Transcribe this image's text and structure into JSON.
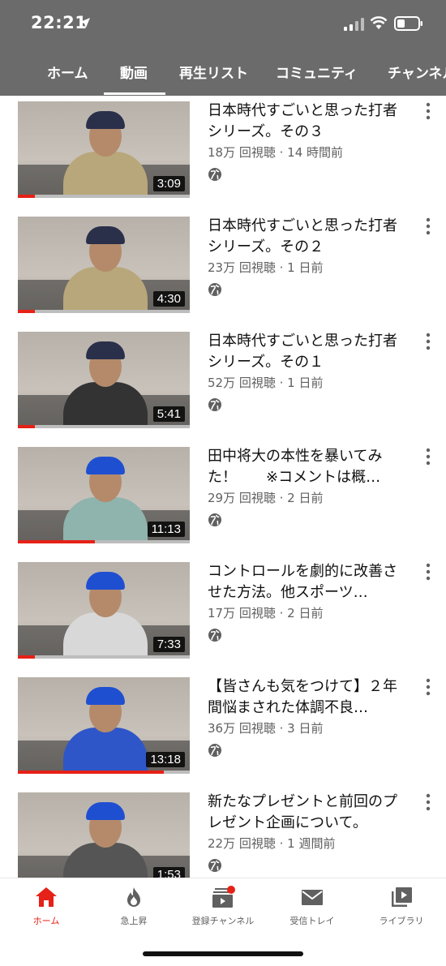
{
  "status_bar": {
    "time": "22:21"
  },
  "tabs": [
    {
      "label": "ホーム"
    },
    {
      "label": "動画"
    },
    {
      "label": "再生リスト"
    },
    {
      "label": "コミュニティ"
    },
    {
      "label": "チャンネル"
    }
  ],
  "active_tab": "動画",
  "videos": [
    {
      "title": "日本時代すごいと思った打者シリーズ。その３",
      "meta": "18万 回視聴 · 14 時間前",
      "duration": "3:09",
      "watched": 0.1,
      "cap_color": "#2a2f4a",
      "shirt_color": "#b8a77a"
    },
    {
      "title": "日本時代すごいと思った打者シリーズ。その２",
      "meta": "23万 回視聴 · 1 日前",
      "duration": "4:30",
      "watched": 0.1,
      "cap_color": "#2a2f4a",
      "shirt_color": "#b8a77a"
    },
    {
      "title": "日本時代すごいと思った打者シリーズ。その１",
      "meta": "52万 回視聴 · 1 日前",
      "duration": "5:41",
      "watched": 0.1,
      "cap_color": "#2a2f4a",
      "shirt_color": "#333333"
    },
    {
      "title": "田中将大の本性を暴いてみた！　　※コメントは概…",
      "meta": "29万 回視聴 · 2 日前",
      "duration": "11:13",
      "watched": 0.45,
      "cap_color": "#1f4fd1",
      "shirt_color": "#8fb3ad"
    },
    {
      "title": "コントロールを劇的に改善させた方法。他スポーツ…",
      "meta": "17万 回視聴 · 2 日前",
      "duration": "7:33",
      "watched": 0.1,
      "cap_color": "#1f4fd1",
      "shirt_color": "#d8d8d8"
    },
    {
      "title": "【皆さんも気をつけて】２年間悩まされた体調不良…",
      "meta": "36万 回視聴 · 3 日前",
      "duration": "13:18",
      "watched": 0.85,
      "cap_color": "#1f4fd1",
      "shirt_color": "#2f56c8"
    },
    {
      "title": "新たなプレゼントと前回のプレゼント企画について。",
      "meta": "22万 回視聴 · 1 週間前",
      "duration": "1:53",
      "watched": 0.0,
      "cap_color": "#1f4fd1",
      "shirt_color": "#555555"
    }
  ],
  "bottom_nav": [
    {
      "label": "ホーム",
      "icon": "home-icon",
      "active": true
    },
    {
      "label": "急上昇",
      "icon": "trending-icon",
      "active": false
    },
    {
      "label": "登録チャンネル",
      "icon": "subscriptions-icon",
      "active": false
    },
    {
      "label": "受信トレイ",
      "icon": "inbox-icon",
      "active": false
    },
    {
      "label": "ライブラリ",
      "icon": "library-icon",
      "active": false
    }
  ],
  "colors": {
    "header_bg": "#6b6b6b",
    "accent": "#e62117"
  }
}
